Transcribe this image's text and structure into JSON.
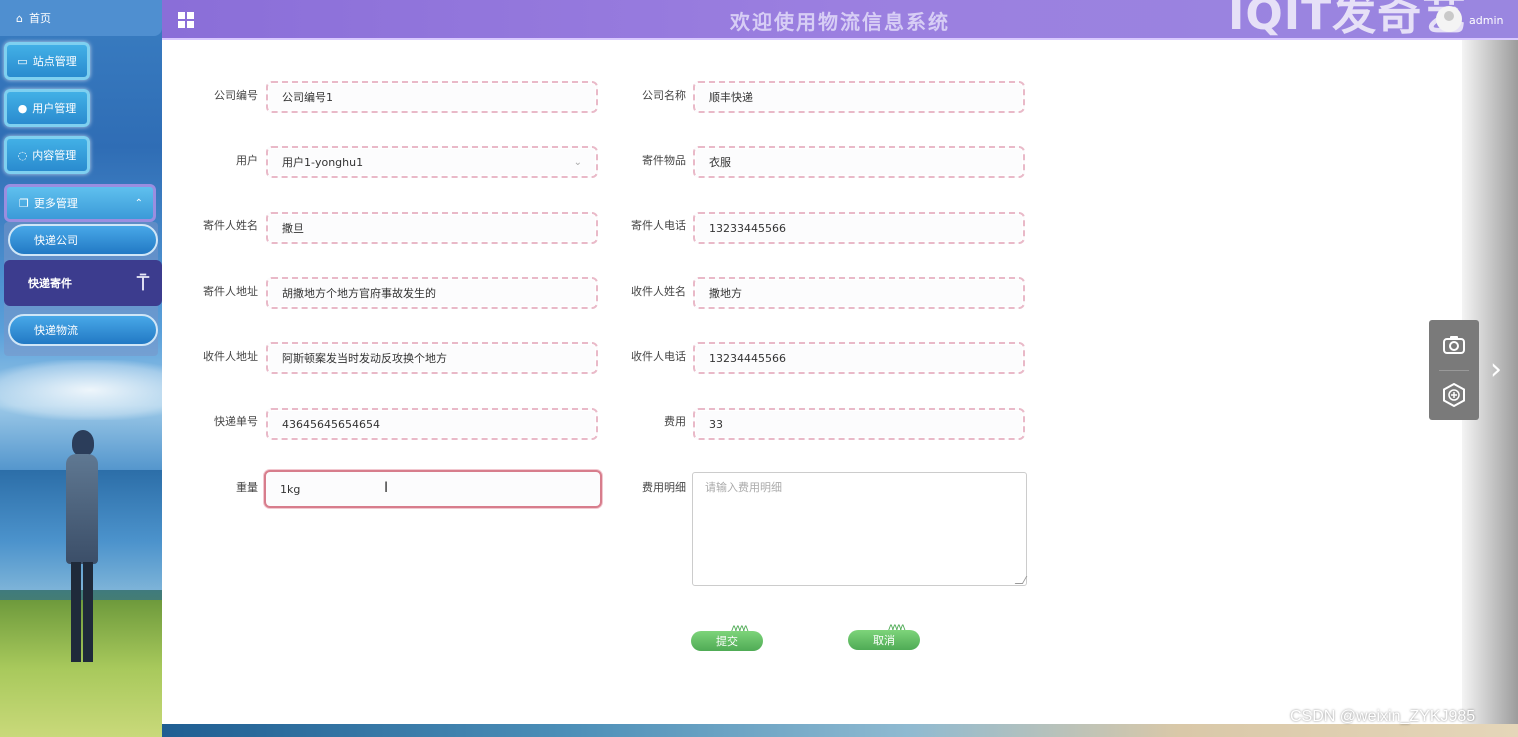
{
  "header": {
    "title": "欢迎使用物流信息系统",
    "watermark": "IQIT发奇艺",
    "username": "admin"
  },
  "sidebar": {
    "home_label": "首页",
    "items": [
      {
        "label": "站点管理",
        "icon": "monitor-icon"
      },
      {
        "label": "用户管理",
        "icon": "user-icon"
      },
      {
        "label": "内容管理",
        "icon": "chat-icon"
      }
    ],
    "more": {
      "label": "更多管理",
      "icon": "copy-icon"
    },
    "submenu": [
      {
        "label": "快递公司"
      },
      {
        "label": "快递寄件",
        "active": true
      },
      {
        "label": "快递物流"
      }
    ]
  },
  "form": {
    "company_no": {
      "label": "公司编号",
      "value": "公司编号1"
    },
    "company_name": {
      "label": "公司名称",
      "value": "顺丰快递"
    },
    "user": {
      "label": "用户",
      "value": "用户1-yonghu1"
    },
    "item": {
      "label": "寄件物品",
      "value": "衣服"
    },
    "sender_name": {
      "label": "寄件人姓名",
      "value": "撒旦"
    },
    "sender_phone": {
      "label": "寄件人电话",
      "value": "13233445566"
    },
    "sender_address": {
      "label": "寄件人地址",
      "value": "胡撒地方个地方官府事故发生的"
    },
    "receiver_name": {
      "label": "收件人姓名",
      "value": "撒地方"
    },
    "receiver_address": {
      "label": "收件人地址",
      "value": "阿斯顿案发当时发动反攻换个地方"
    },
    "receiver_phone": {
      "label": "收件人电话",
      "value": "13234445566"
    },
    "tracking_no": {
      "label": "快递单号",
      "value": "43645645654654"
    },
    "fee": {
      "label": "费用",
      "value": "33"
    },
    "weight": {
      "label": "重量",
      "value": "1kg"
    },
    "fee_detail": {
      "label": "费用明细",
      "placeholder": "请输入费用明细"
    },
    "submit_label": "提交",
    "cancel_label": "取消"
  },
  "footer": {
    "watermark": "CSDN @weixin_ZYKJ985"
  },
  "colors": {
    "header_bg": "#9b7fe0",
    "sidebar_btn": "#2a8bcf",
    "active_sub": "#3c3c8e",
    "field_border": "#e9b9c8",
    "button_green": "#4fab55"
  }
}
